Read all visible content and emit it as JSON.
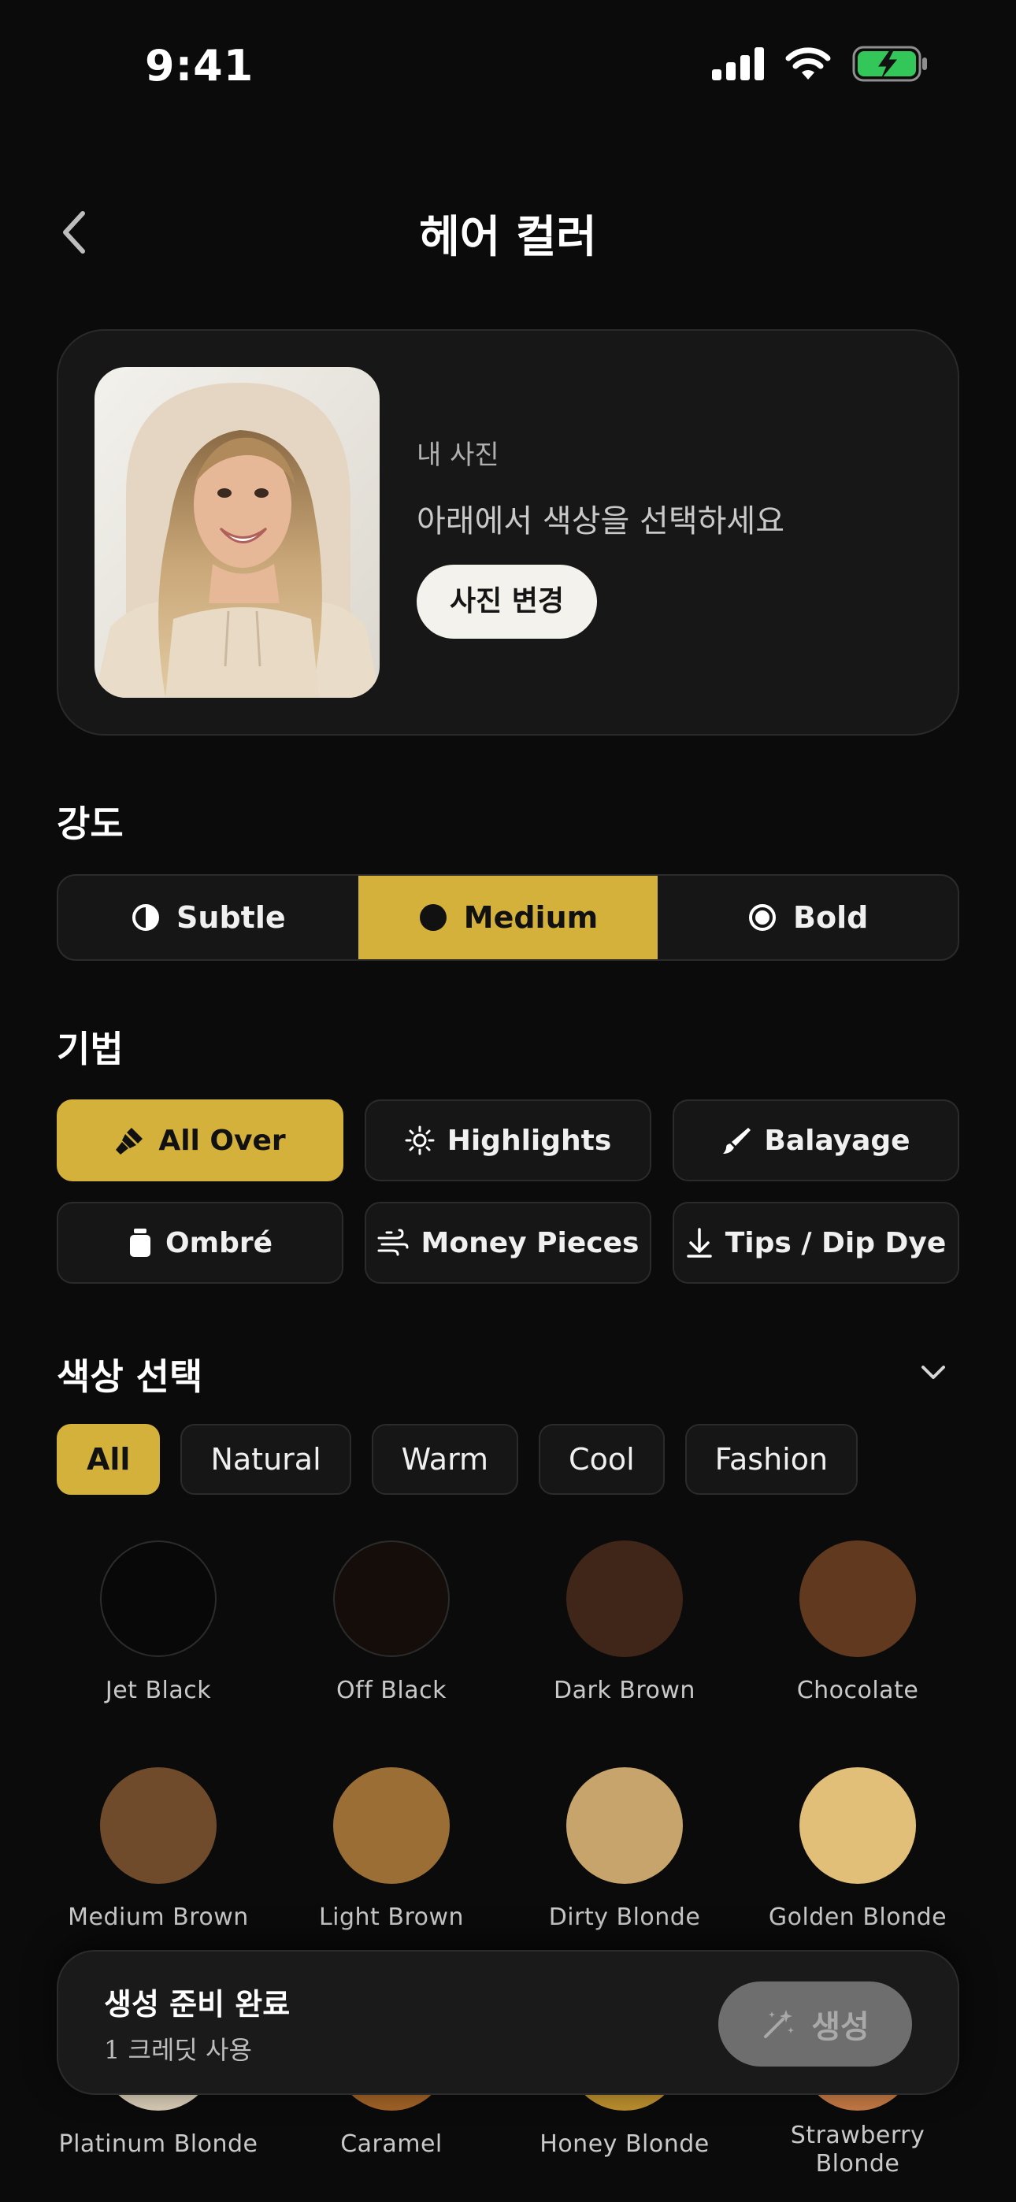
{
  "status": {
    "time": "9:41"
  },
  "header": {
    "title": "헤어 컬러"
  },
  "photo_card": {
    "label": "내 사진",
    "hint": "아래에서 색상을 선택하세요",
    "change_button": "사진 변경"
  },
  "intensity": {
    "title": "강도",
    "options": [
      {
        "label": "Subtle",
        "icon": "half-circle-icon",
        "selected": false
      },
      {
        "label": "Medium",
        "icon": "filled-circle-icon",
        "selected": true
      },
      {
        "label": "Bold",
        "icon": "target-circle-icon",
        "selected": false
      }
    ]
  },
  "technique": {
    "title": "기법",
    "options": [
      {
        "label": "All Over",
        "icon": "paint-brush-icon",
        "selected": true
      },
      {
        "label": "Highlights",
        "icon": "sun-icon",
        "selected": false
      },
      {
        "label": "Balayage",
        "icon": "brush-stroke-icon",
        "selected": false
      },
      {
        "label": "Ombré",
        "icon": "bottle-icon",
        "selected": false
      },
      {
        "label": "Money Pieces",
        "icon": "wind-icon",
        "selected": false
      },
      {
        "label": "Tips / Dip Dye",
        "icon": "arrow-down-icon",
        "selected": false
      }
    ]
  },
  "color_select": {
    "title": "색상 선택",
    "filters": [
      {
        "label": "All",
        "selected": true
      },
      {
        "label": "Natural",
        "selected": false
      },
      {
        "label": "Warm",
        "selected": false
      },
      {
        "label": "Cool",
        "selected": false
      },
      {
        "label": "Fashion",
        "selected": false
      }
    ],
    "swatches": [
      {
        "name": "Jet Black",
        "color": "#080808"
      },
      {
        "name": "Off Black",
        "color": "#140d0a"
      },
      {
        "name": "Dark Brown",
        "color": "#3f2618"
      },
      {
        "name": "Chocolate",
        "color": "#61391f"
      },
      {
        "name": "Medium Brown",
        "color": "#6f4b2c"
      },
      {
        "name": "Light Brown",
        "color": "#9a6e35"
      },
      {
        "name": "Dirty Blonde",
        "color": "#c7a46b"
      },
      {
        "name": "Golden Blonde",
        "color": "#e2bf78"
      },
      {
        "name": "Platinum Blonde",
        "color": "#d9cdb7"
      },
      {
        "name": "Caramel",
        "color": "#a26327"
      },
      {
        "name": "Honey Blonde",
        "color": "#bd902e"
      },
      {
        "name": "Strawberry Blonde",
        "color": "#c57a45"
      }
    ]
  },
  "bottom_bar": {
    "title": "생성 준비 완료",
    "subtitle": "1 크레딧 사용",
    "generate_button": "생성"
  },
  "colors": {
    "accent": "#d4b13a",
    "background": "#0b0b0b",
    "card": "#171717"
  }
}
